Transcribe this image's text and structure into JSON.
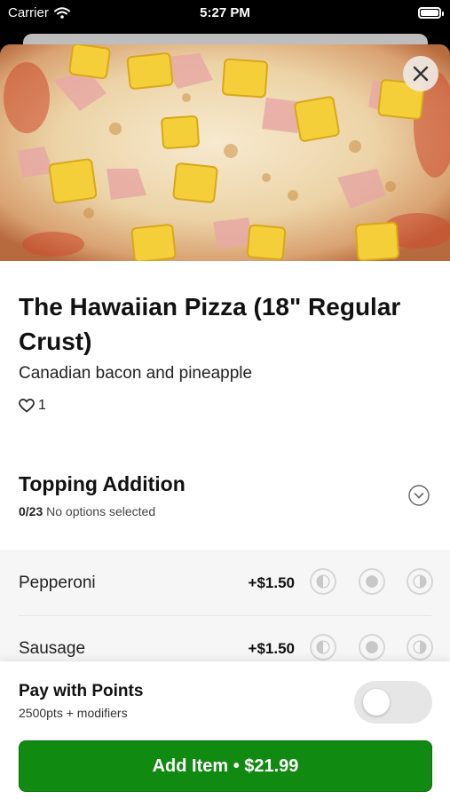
{
  "status_bar": {
    "carrier": "Carrier",
    "time": "5:27 PM"
  },
  "item": {
    "title": "The Hawaiian Pizza (18\" Regular Crust)",
    "description": "Canadian bacon and pineapple",
    "likes": "1"
  },
  "modifier_group": {
    "title": "Topping Addition",
    "count": "0/23",
    "status": "No options selected",
    "options": [
      {
        "name": "Pepperoni",
        "price": "+$1.50"
      },
      {
        "name": "Sausage",
        "price": "+$1.50"
      }
    ]
  },
  "footer": {
    "points_title": "Pay with Points",
    "points_sub": "2500pts + modifiers",
    "add_button": "Add Item • $21.99"
  },
  "colors": {
    "accent": "#118a11",
    "sheet_bg": "#ffffff"
  }
}
